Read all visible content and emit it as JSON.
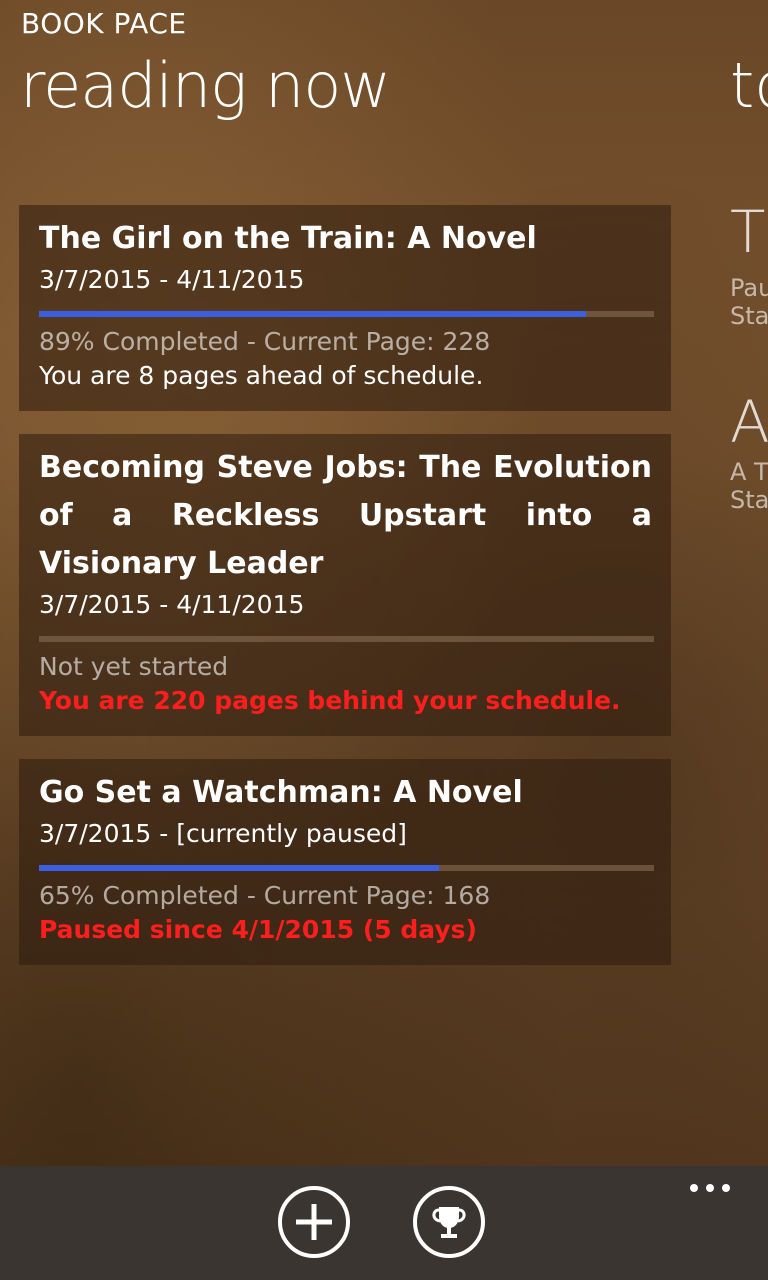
{
  "app": {
    "title": "BOOK PACE"
  },
  "pivot": {
    "current": "reading now",
    "next": "to"
  },
  "peek": {
    "item1": {
      "initial": "T",
      "line1": "Pau",
      "line2": "Sta"
    },
    "item2": {
      "initial": "A",
      "line1": "A T",
      "line2": "Sta"
    }
  },
  "books": [
    {
      "title": "The Girl on the Train: A Novel",
      "dates": "3/7/2015 - 4/11/2015",
      "progress": 0.89,
      "status": "89% Completed - Current Page: 228",
      "schedule": "You are 8 pages ahead of schedule."
    },
    {
      "title": "Becoming Steve Jobs: The Evolution of a Reckless Upstart into a Visionary Leader",
      "dates": "3/7/2015 - 4/11/2015",
      "progress": 0,
      "status": "Not yet started",
      "schedule": "You are 220 pages behind your schedule."
    },
    {
      "title": "Go Set a Watchman: A Novel",
      "dates": "3/7/2015 - [currently paused]",
      "progress": 0.65,
      "status": "65% Completed - Current Page: 168",
      "schedule": "Paused since 4/1/2015 (5 days)"
    }
  ],
  "app_bar": {
    "add_icon": "plus-circle-icon",
    "achievements_icon": "trophy-icon",
    "more_icon": "ellipsis-icon"
  },
  "colors": {
    "progress_fill": "#3a5fe0",
    "alert_text": "#ff1e1e"
  }
}
